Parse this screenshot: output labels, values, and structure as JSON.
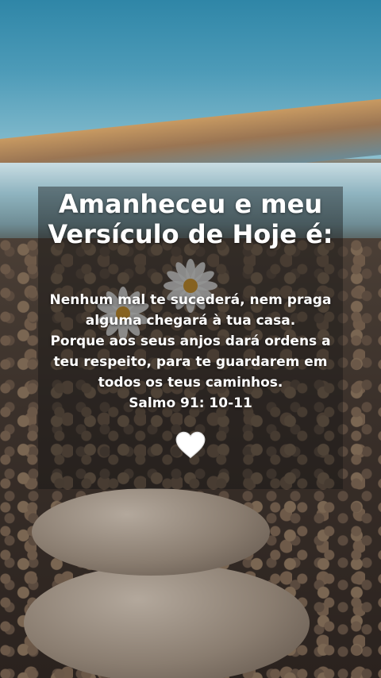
{
  "title_line1": "Amanheceu e meu",
  "title_line2": "Versículo de Hoje é:",
  "verse_lines": [
    "Nenhum mal te sucederá, nem praga",
    "alguma chegará à tua casa.",
    "Porque aos seus anjos dará ordens a",
    "teu respeito, para te guardarem em",
    "todos os teus caminhos."
  ],
  "reference": "Salmo 91: 10-11",
  "icons": {
    "heart": "white-heart-icon"
  },
  "colors": {
    "text": "#ffffff",
    "heart": "#ffffff"
  }
}
